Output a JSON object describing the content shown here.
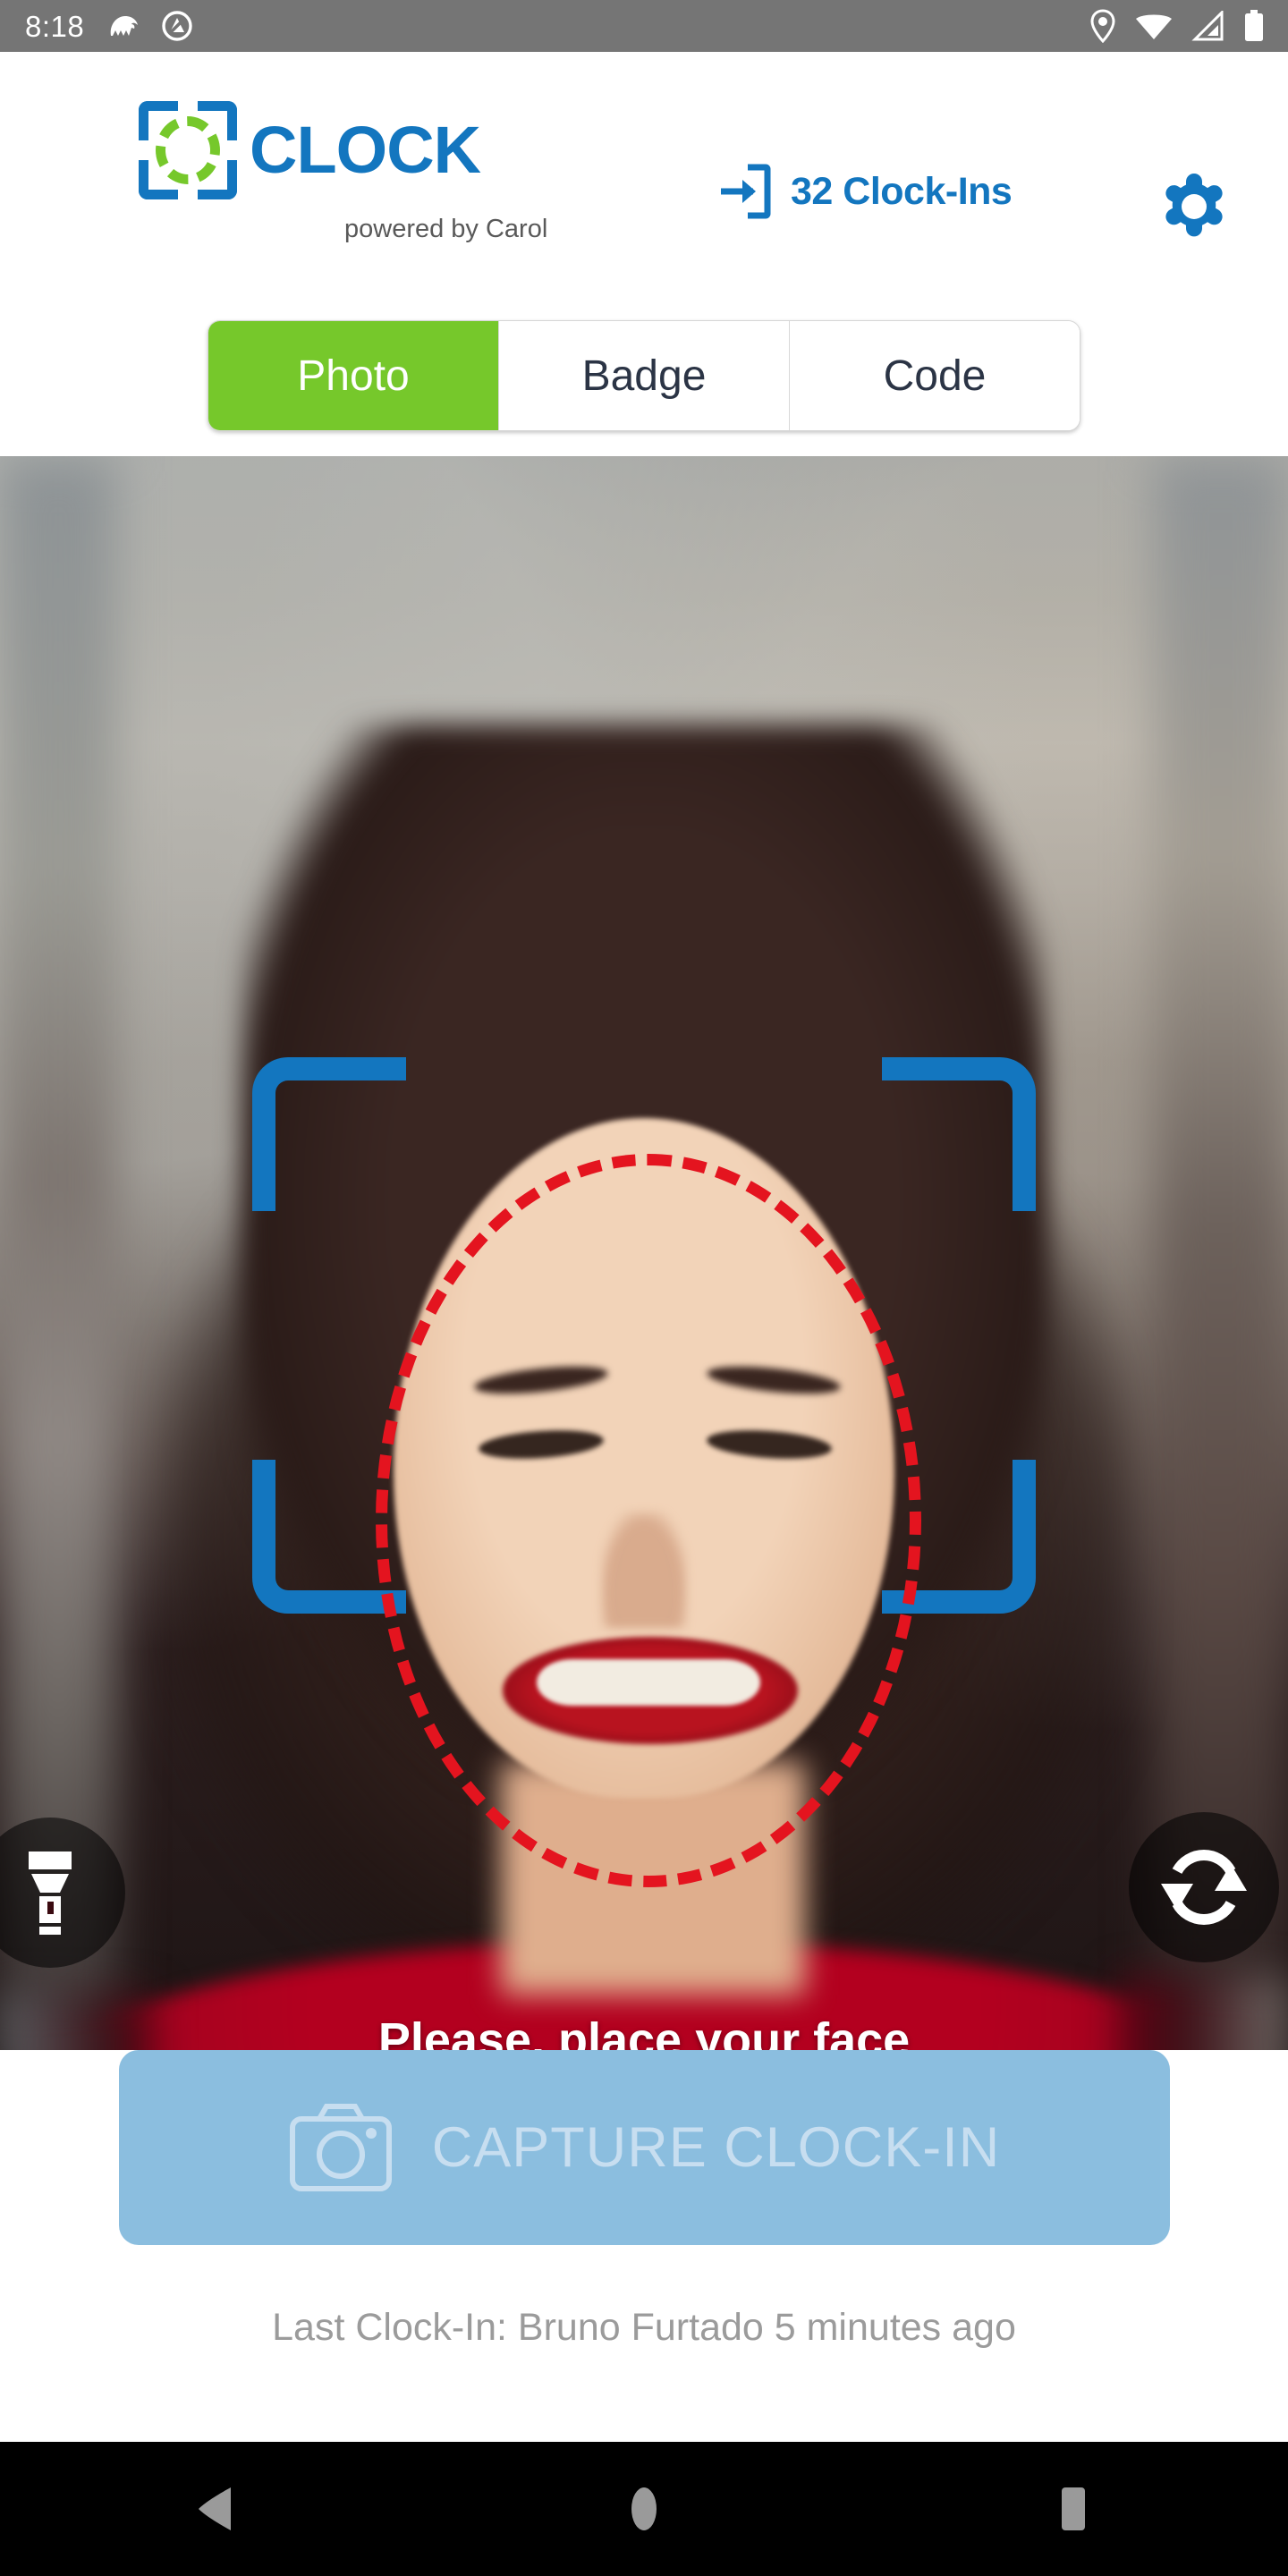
{
  "status_bar": {
    "time": "8:18",
    "left_icons": [
      "pokemon-app-icon",
      "privacy-blocked-icon"
    ],
    "right_icons": [
      "location-pin-icon",
      "wifi-icon",
      "cellular-signal-icon",
      "battery-icon"
    ]
  },
  "header": {
    "logo_text": "CLOCK",
    "tagline": "powered by Carol",
    "clock_ins_count_label": "32 Clock-Ins",
    "settings_icon": "gear-icon",
    "login_icon": "enter-arrow-icon"
  },
  "tabs": {
    "items": [
      {
        "label": "Photo",
        "active": true
      },
      {
        "label": "Badge",
        "active": false
      },
      {
        "label": "Code",
        "active": false
      }
    ]
  },
  "preview": {
    "hint_text": "Please, place your face",
    "torch_icon": "flashlight-icon",
    "flip_icon": "switch-camera-icon",
    "face_guide": "dashed-oval-guide",
    "frame_guide": "corner-brackets-guide"
  },
  "capture": {
    "label": "CAPTURE CLOCK-IN",
    "icon": "camera-icon",
    "enabled": false
  },
  "footer": {
    "last_clock_in": "Last Clock-In: Bruno Furtado 5 minutes ago"
  },
  "navigation_bar": {
    "back_label": "back-icon",
    "home_label": "home-icon",
    "recents_label": "recents-icon"
  },
  "colors": {
    "brand_blue": "#1376BF",
    "brand_green": "#76C82B",
    "guide_red": "#E4141F",
    "capture_blue": "#8BBEDF",
    "status_bar_gray": "#757575"
  }
}
